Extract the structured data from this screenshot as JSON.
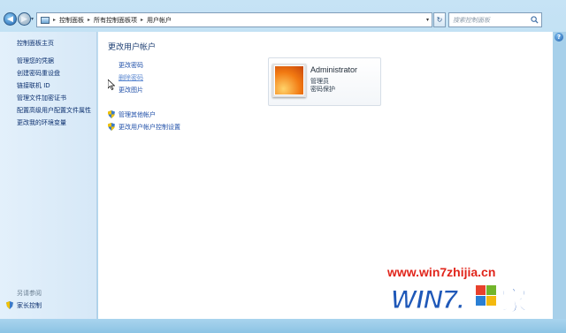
{
  "address": {
    "crumbs": [
      "控制面板",
      "所有控制面板项",
      "用户帐户"
    ]
  },
  "search": {
    "placeholder": "搜索控制面板"
  },
  "left_pane": {
    "home": "控制面板主页",
    "links": [
      "管理您的凭据",
      "创建密码重设盘",
      "链接联机 ID",
      "管理文件加密证书",
      "配置高级用户配置文件属性",
      "更改我的环境变量"
    ],
    "see_also": "另请参阅",
    "parental": "家长控制"
  },
  "main": {
    "title": "更改用户帐户",
    "tasks": [
      "更改密码",
      "删除密码",
      "更改图片"
    ],
    "shield_links": [
      "管理其他帐户",
      "更改用户帐户控制设置"
    ]
  },
  "account": {
    "name": "Administrator",
    "role": "管理员",
    "status": "密码保护"
  },
  "watermark": {
    "url": "www.win7zhijia.cn",
    "logo_text": "WIN7.家"
  },
  "colors": {
    "link": "#1f4fa8",
    "nav_link": "#0b2f6e",
    "title": "#1e3f73",
    "watermark_red": "#e1251b"
  }
}
